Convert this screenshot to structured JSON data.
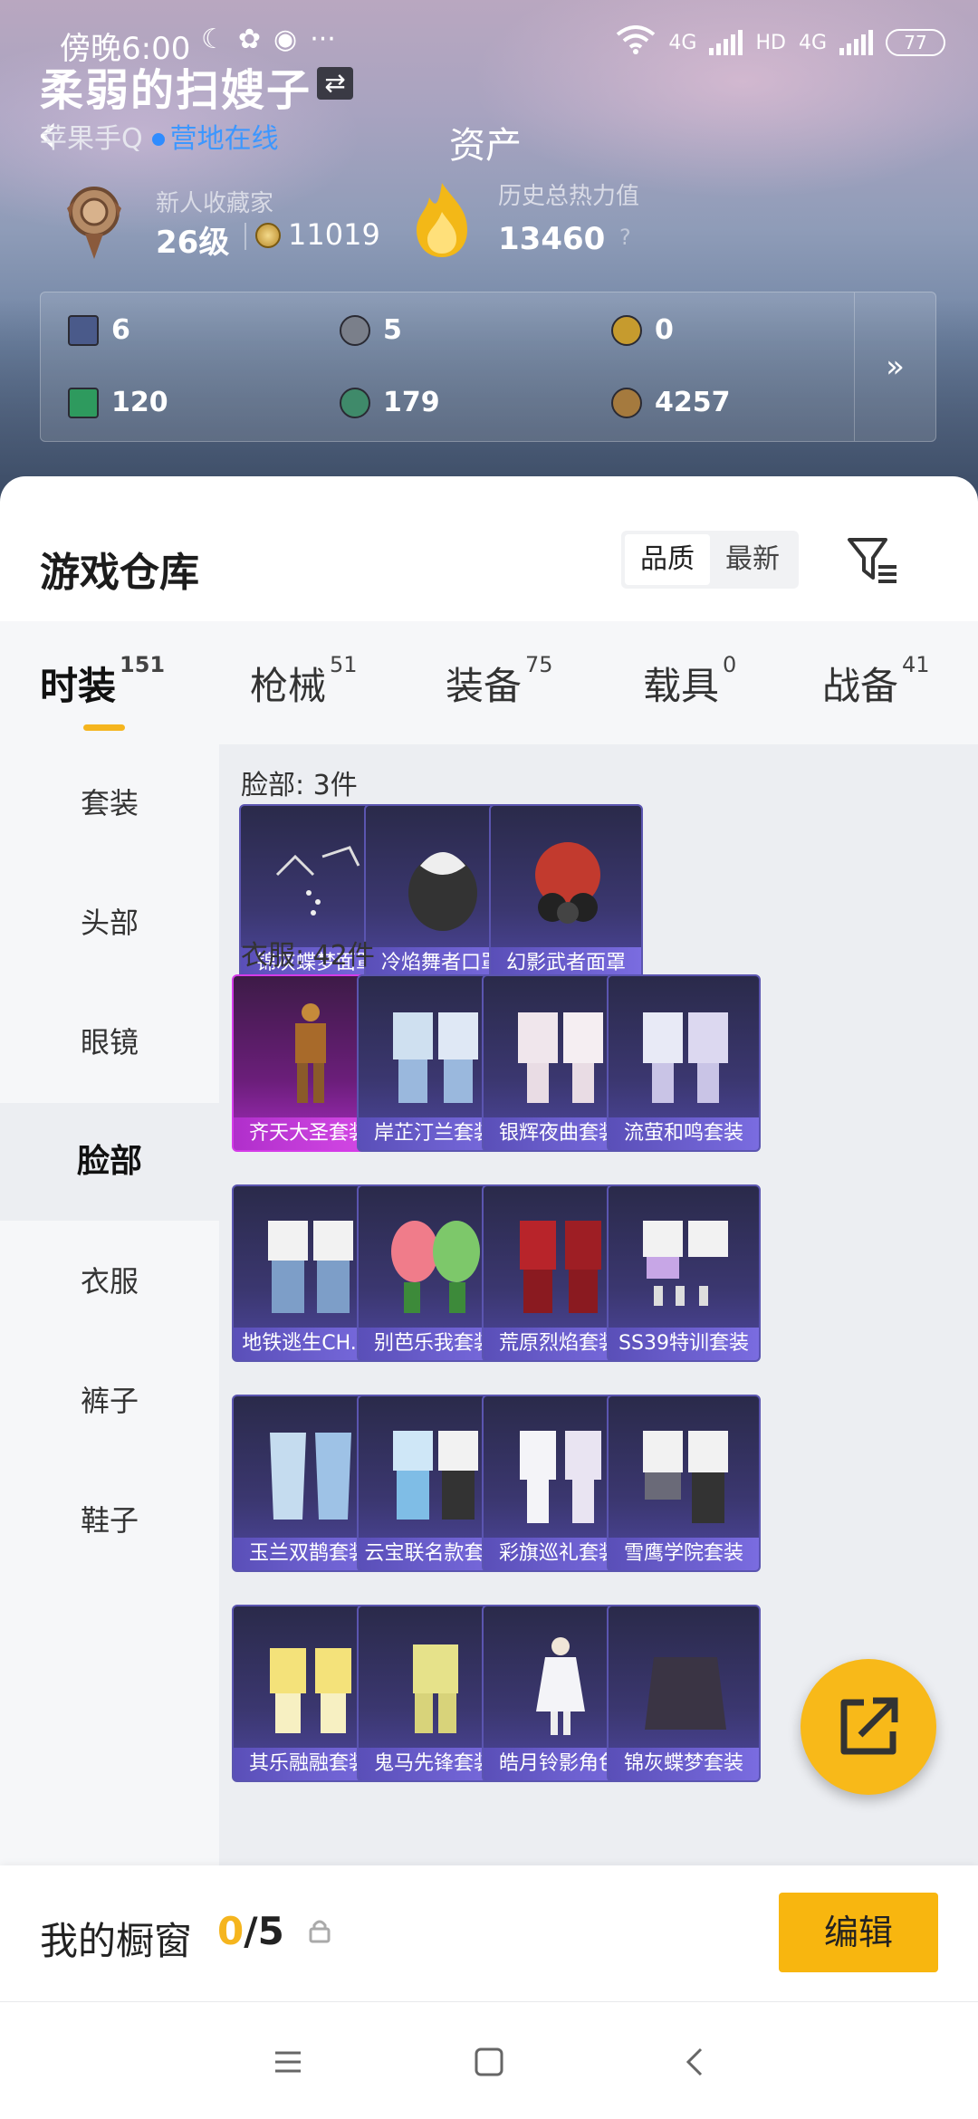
{
  "status": {
    "time": "傍晚6:00",
    "battery": "77",
    "net_label_1": "4G",
    "net_label_2": "HD",
    "net_label_3": "4G"
  },
  "profile": {
    "username": "柔弱的扫嫂子",
    "sub": "苹果手Q",
    "camp": "营地在线",
    "page_title": "资产",
    "level_label": "新人收藏家",
    "level_value": "26级",
    "coin_value": "11019",
    "heat_label": "历史总热力值",
    "heat_value": "13460",
    "help": "?"
  },
  "assets": [
    {
      "value": "6",
      "color": "#4a5a8a"
    },
    {
      "value": "5",
      "color": "#7a7f8a"
    },
    {
      "value": "0",
      "color": "#c69b2e"
    },
    {
      "value": "120",
      "color": "#2e9a5e"
    },
    {
      "value": "179",
      "color": "#3f8a6a"
    },
    {
      "value": "4257",
      "color": "#a57a3e"
    }
  ],
  "assets_more": "»",
  "warehouse": {
    "title": "游戏仓库",
    "sort_quality": "品质",
    "sort_latest": "最新"
  },
  "tabs": [
    {
      "label": "时装",
      "count": "151"
    },
    {
      "label": "枪械",
      "count": "51"
    },
    {
      "label": "装备",
      "count": "75"
    },
    {
      "label": "载具",
      "count": "0"
    },
    {
      "label": "战备",
      "count": "41"
    }
  ],
  "sidebar": [
    "套装",
    "头部",
    "眼镜",
    "脸部",
    "衣服",
    "裤子",
    "鞋子"
  ],
  "sections": {
    "face_title": "脸部: 3件",
    "face_items": [
      "锦灰蝶梦面罩",
      "冷焰舞者口罩",
      "幻影武者面罩"
    ],
    "clothes_title": "衣服: 42件",
    "clothes_items": [
      "齐天大圣套装",
      "岸芷汀兰套装",
      "银辉夜曲套装",
      "流萤和鸣套装",
      "地铁逃生CH....",
      "别芭乐我套装",
      "荒原烈焰套装",
      "SS39特训套装",
      "玉兰双鹊套装",
      "云宝联名款套...",
      "彩旗巡礼套装",
      "雪鹰学院套装",
      "其乐融融套装",
      "鬼马先锋套装",
      "皓月铃影角色",
      "锦灰蝶梦套装"
    ]
  },
  "window": {
    "label": "我的橱窗",
    "current": "0",
    "total": "/5",
    "edit": "编辑"
  },
  "colors": {
    "accent": "#f8b60f",
    "camp_blue": "#3d97ff",
    "item_purple": "#5b55b0",
    "item_legendary": "#d43be8"
  }
}
